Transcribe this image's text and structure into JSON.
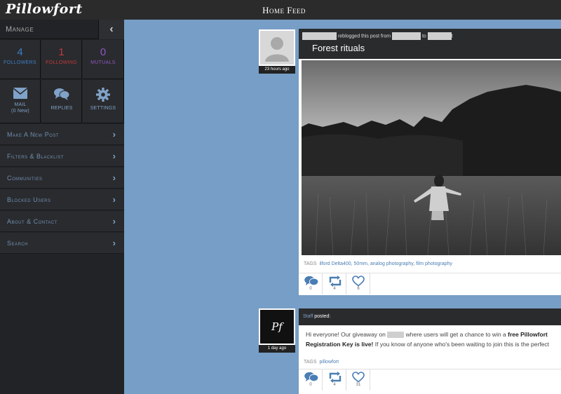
{
  "app": {
    "logo": "Pillowfort",
    "page_title": "Home Feed"
  },
  "sidebar": {
    "manage_label": "Manage",
    "stats": [
      {
        "count": "4",
        "label": "FOLLOWERS",
        "color": "#3c7ec4"
      },
      {
        "count": "1",
        "label": "FOLLOWING",
        "color": "#c1393e"
      },
      {
        "count": "0",
        "label": "MUTUALS",
        "color": "#8f56c2"
      }
    ],
    "tools": [
      {
        "label": "MAIL",
        "sublabel": "(0 New)",
        "icon": "envelope-icon"
      },
      {
        "label": "REPLIES",
        "icon": "chat-bubbles-icon"
      },
      {
        "label": "SETTINGS",
        "icon": "gear-icon"
      }
    ],
    "menu": [
      {
        "label": "Make A New Post"
      },
      {
        "label": "Filters & Blacklist"
      },
      {
        "label": "Communities"
      },
      {
        "label": "Blocked Users"
      },
      {
        "label": "About & Contact"
      },
      {
        "label": "Search"
      }
    ]
  },
  "posts": [
    {
      "time": "23 hours ago",
      "reblog_text": "reblogged this post from",
      "reblog_to": "to",
      "title": "Forest rituals",
      "tags_label": "TAGS",
      "tags": [
        "ilford Delta400",
        "50mm",
        "analog photography",
        "film photography"
      ],
      "counts": {
        "comments": "0",
        "reblogs": "4",
        "likes": "6"
      }
    },
    {
      "time": "1 day ago",
      "author": "Staff",
      "posted_label": "posted:",
      "body_part1": "Hi everyone! Our giveaway on",
      "body_part2": "where users will get a chance to win a",
      "body_bold": "free Pillowfort Registration Key is live!",
      "body_part3": "If you know of anyone who's been waiting to join this is the perfect post to share with them!",
      "avatar_text": "Pf",
      "tags_label": "TAGS",
      "tags": [
        "pillowfort"
      ],
      "counts": {
        "comments": "0",
        "reblogs": "4",
        "likes": "31"
      }
    }
  ],
  "colors": {
    "feed_bg": "#779ec6",
    "link": "#4a7db3",
    "action_icon": "#4a7db3"
  }
}
